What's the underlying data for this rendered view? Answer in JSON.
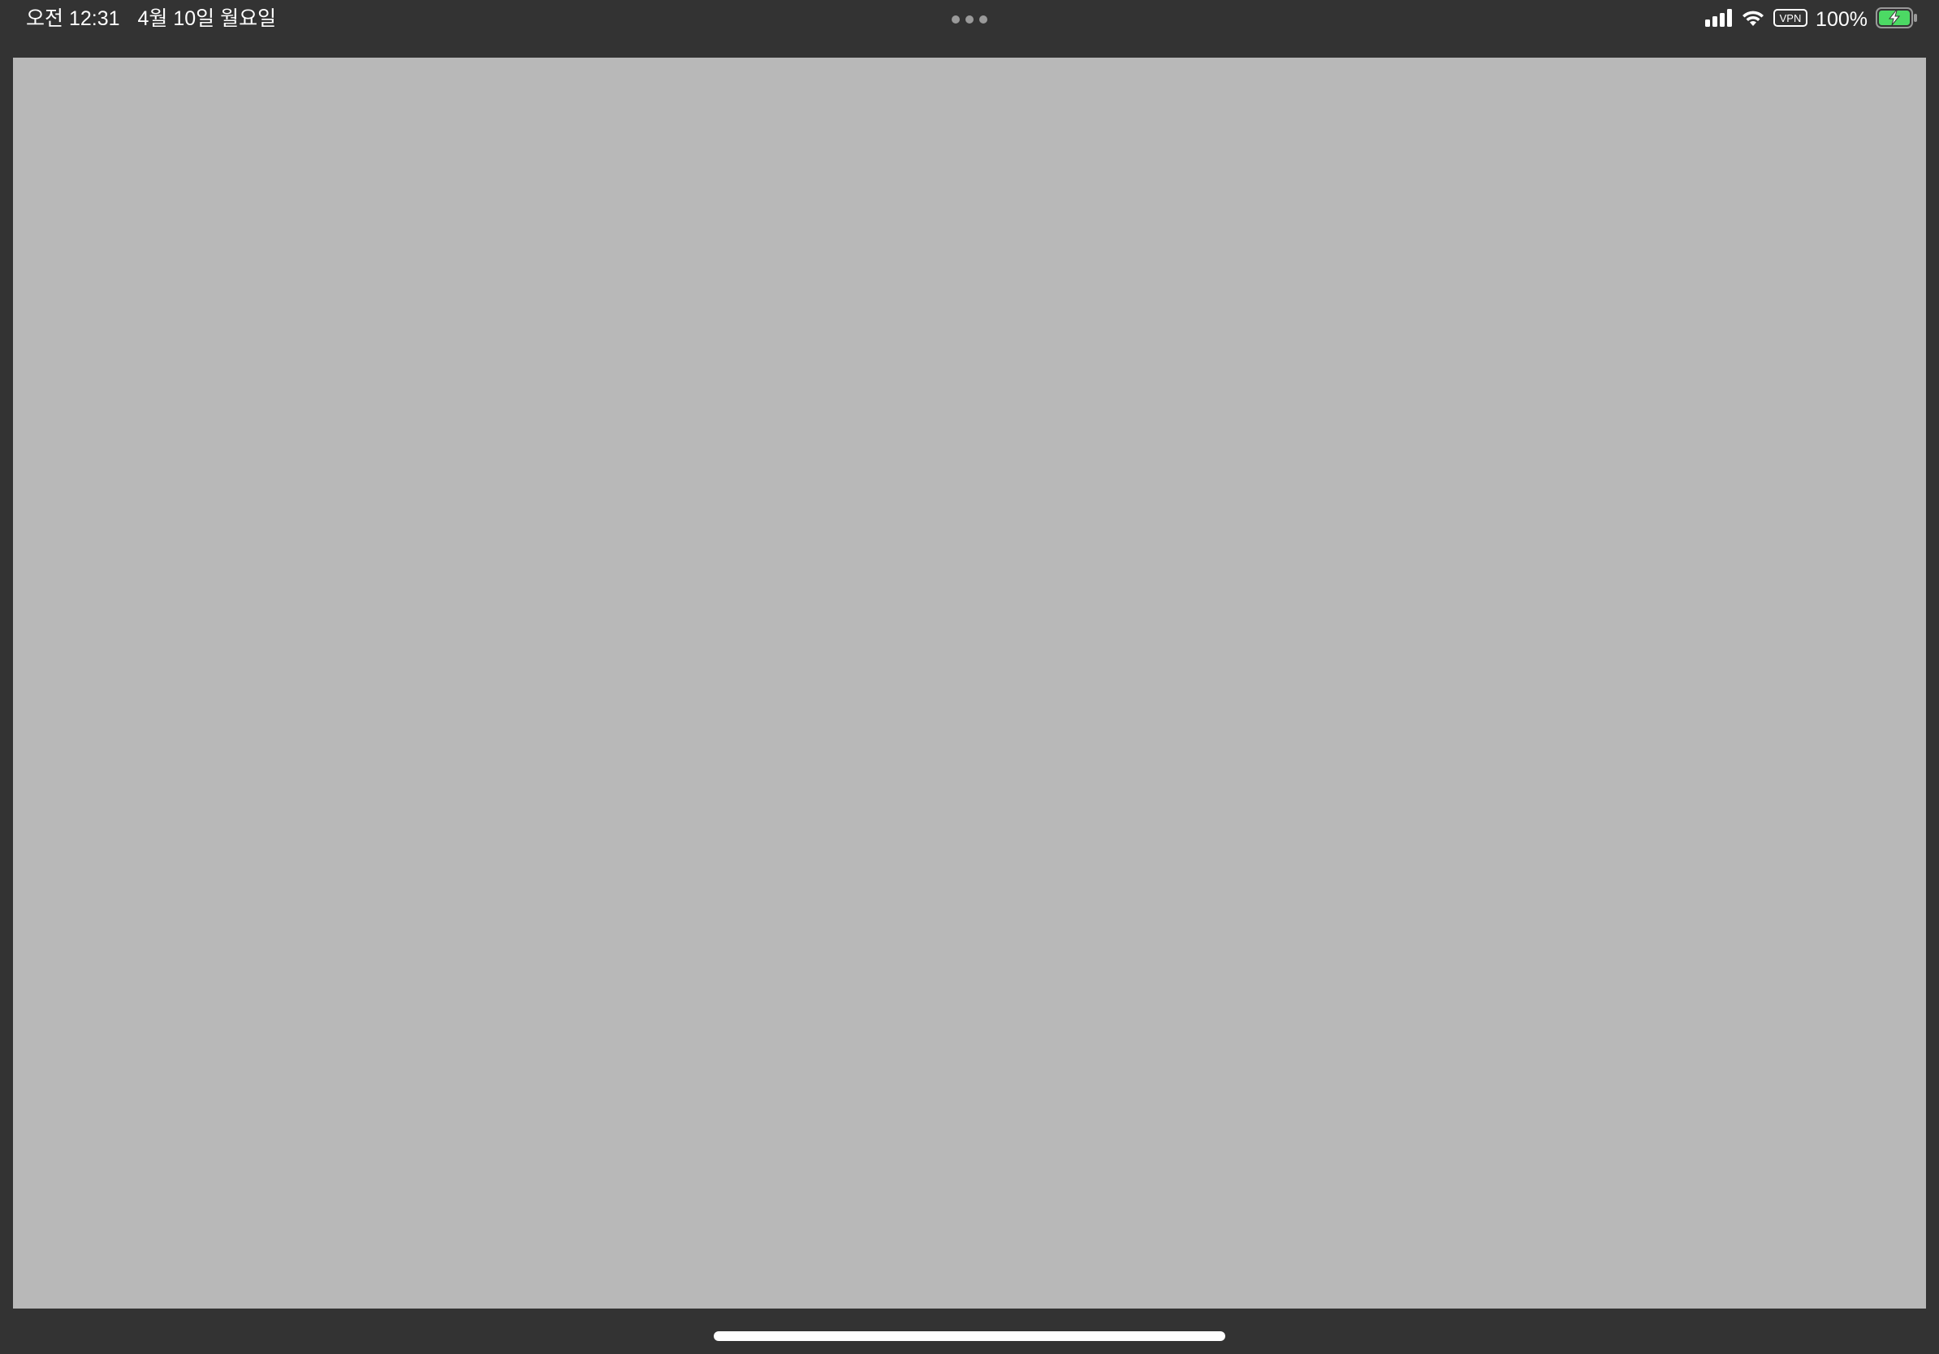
{
  "status_bar": {
    "time": "오전 12:31",
    "date": "4월 10일 월요일",
    "vpn_label": "VPN",
    "battery_percent": "100%",
    "battery_level": 1.0,
    "battery_charging": true,
    "battery_color": "#4cd964",
    "icons": [
      "cellular-signal-icon",
      "wifi-icon",
      "vpn-icon",
      "battery-charging-icon"
    ]
  },
  "multitasking": {
    "icon": "multitasking-dots-icon"
  },
  "main": {
    "content_color": "#b8b8b8"
  },
  "home_indicator": {
    "icon": "home-indicator"
  }
}
